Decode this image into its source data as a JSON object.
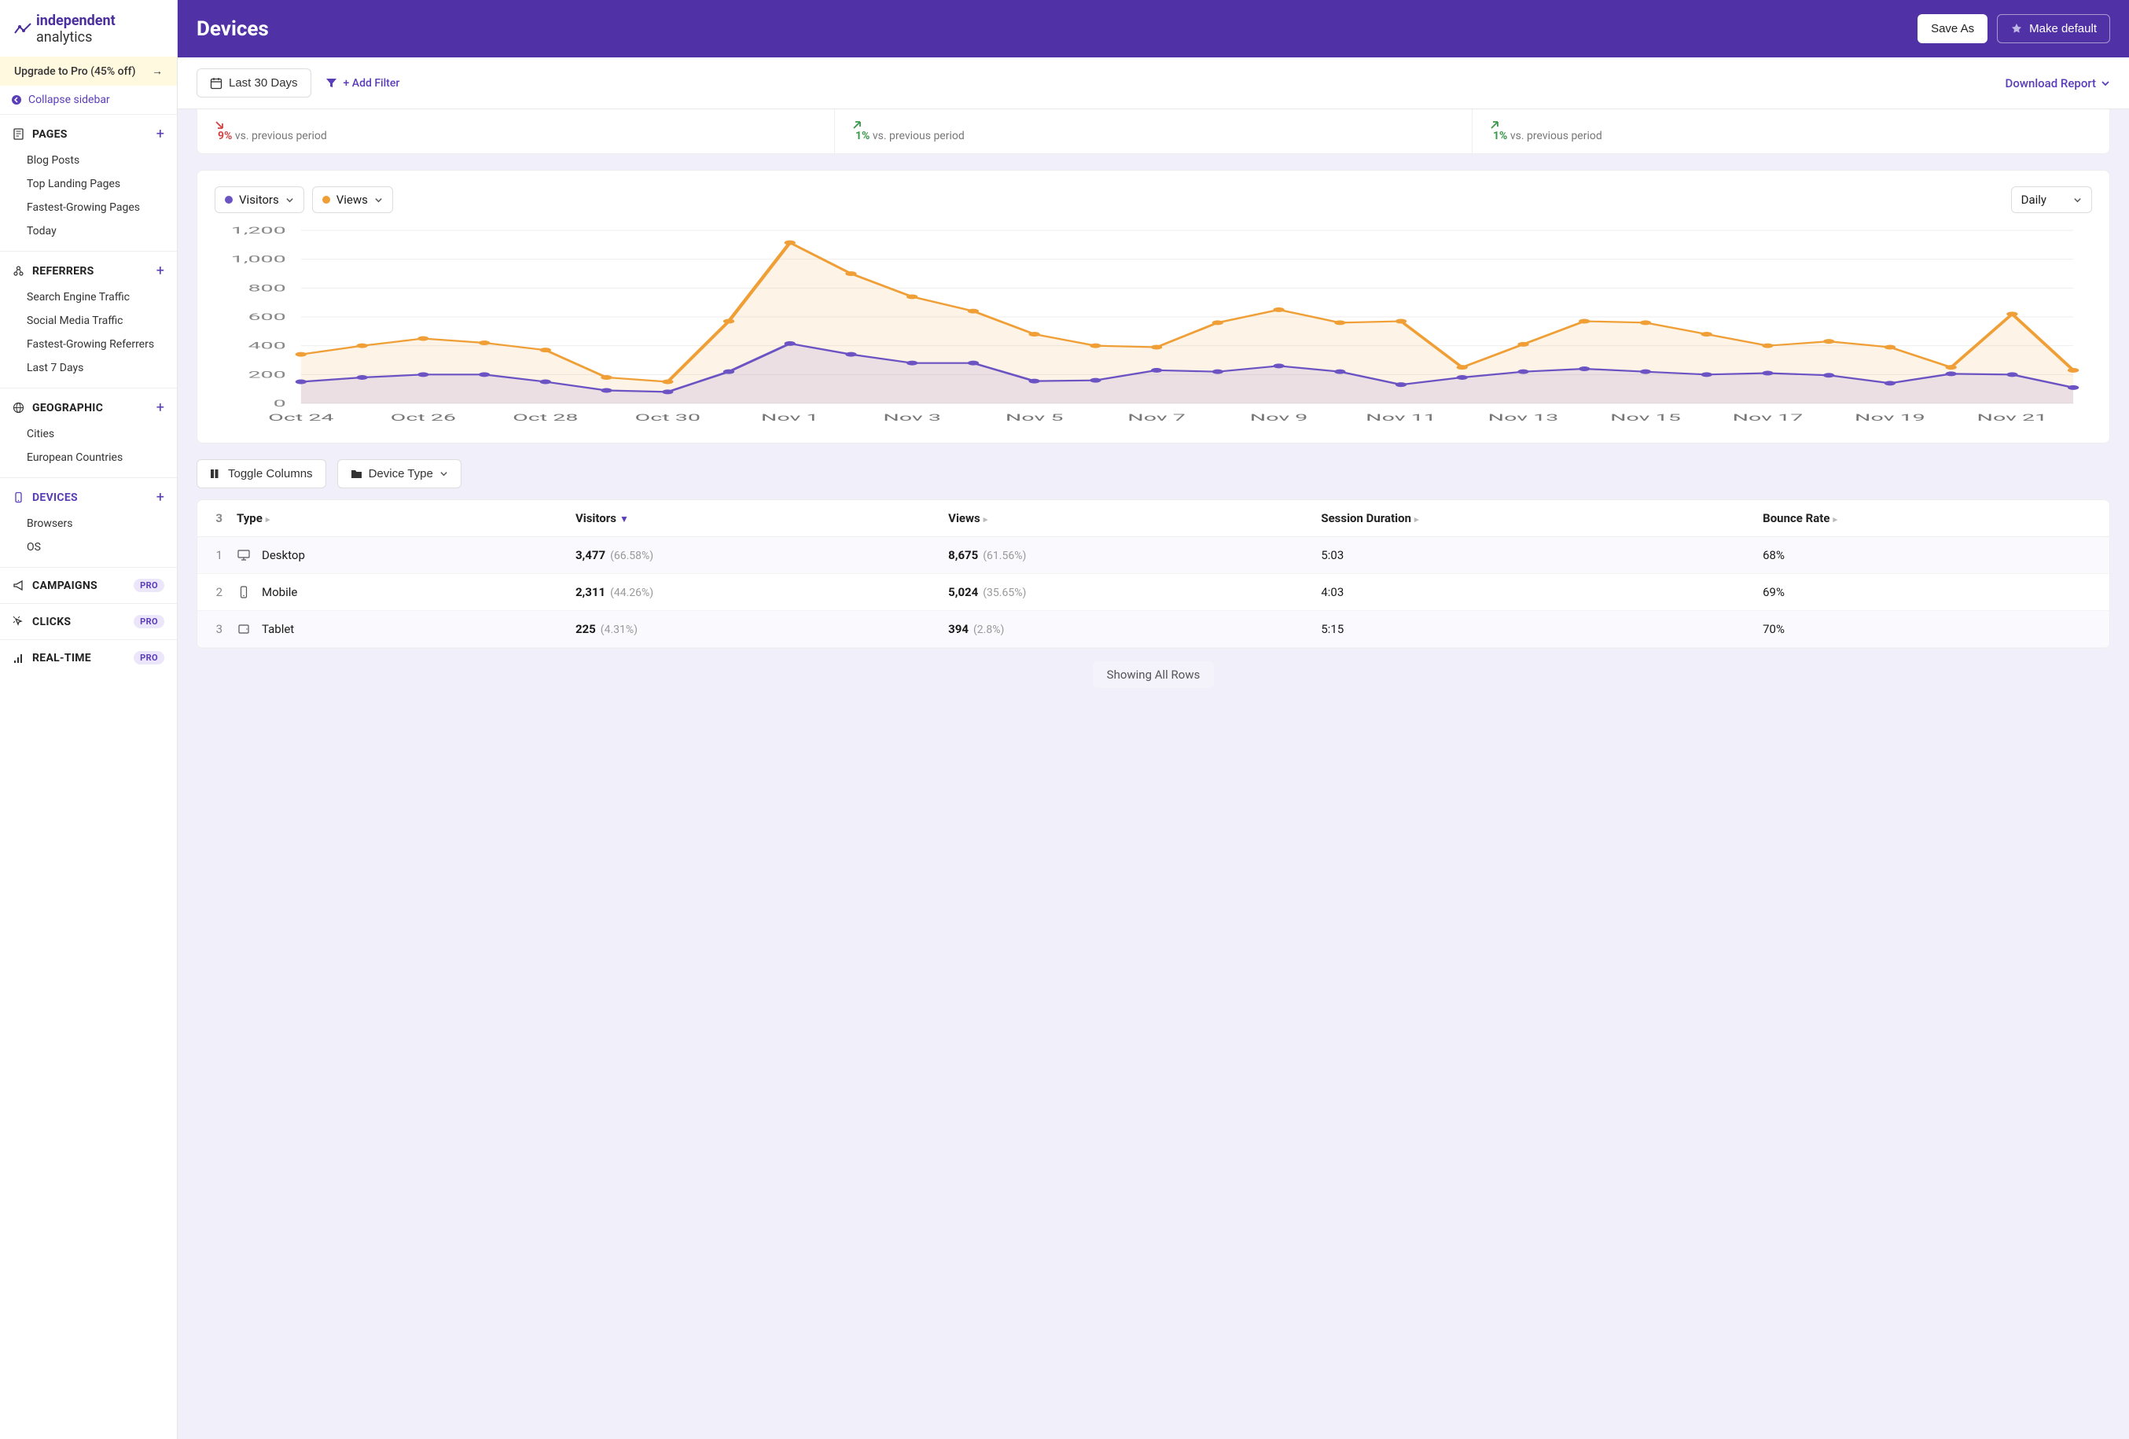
{
  "brand": {
    "name": "independent",
    "suffix": " analytics"
  },
  "sidebar": {
    "upgrade": "Upgrade to Pro (45% off)",
    "collapse": "Collapse sidebar",
    "sections": [
      {
        "title": "PAGES",
        "items": [
          "Blog Posts",
          "Top Landing Pages",
          "Fastest-Growing Pages",
          "Today"
        ]
      },
      {
        "title": "REFERRERS",
        "items": [
          "Search Engine Traffic",
          "Social Media Traffic",
          "Fastest-Growing Referrers",
          "Last 7 Days"
        ]
      },
      {
        "title": "GEOGRAPHIC",
        "items": [
          "Cities",
          "European Countries"
        ]
      },
      {
        "title": "DEVICES",
        "items": [
          "Browsers",
          "OS"
        ],
        "active": true
      }
    ],
    "pro": [
      {
        "title": "CAMPAIGNS"
      },
      {
        "title": "CLICKS"
      },
      {
        "title": "REAL-TIME"
      }
    ],
    "proBadge": "PRO"
  },
  "header": {
    "title": "Devices",
    "saveAs": "Save As",
    "makeDefault": "Make default"
  },
  "toolbar": {
    "dateRange": "Last 30 Days",
    "addFilter": "+ Add Filter",
    "download": "Download Report"
  },
  "kpis": [
    {
      "dir": "down",
      "value": "9%",
      "label": "vs. previous period"
    },
    {
      "dir": "up",
      "value": "1%",
      "label": "vs. previous period"
    },
    {
      "dir": "up",
      "value": "1%",
      "label": "vs. previous period"
    }
  ],
  "chart": {
    "metricA": "Visitors",
    "metricB": "Views",
    "interval": "Daily"
  },
  "chart_data": {
    "type": "line",
    "categories": [
      "Oct 24",
      "Oct 25",
      "Oct 26",
      "Oct 27",
      "Oct 28",
      "Oct 29",
      "Oct 30",
      "Oct 31",
      "Nov 1",
      "Nov 2",
      "Nov 3",
      "Nov 4",
      "Nov 5",
      "Nov 6",
      "Nov 7",
      "Nov 8",
      "Nov 9",
      "Nov 10",
      "Nov 11",
      "Nov 12",
      "Nov 13",
      "Nov 14",
      "Nov 15",
      "Nov 16",
      "Nov 17",
      "Nov 18",
      "Nov 19",
      "Nov 20",
      "Nov 21",
      "Nov 22"
    ],
    "xTickLabels": [
      "Oct 24",
      "Oct 26",
      "Oct 28",
      "Oct 30",
      "Nov 1",
      "Nov 3",
      "Nov 5",
      "Nov 7",
      "Nov 9",
      "Nov 11",
      "Nov 13",
      "Nov 15",
      "Nov 17",
      "Nov 19",
      "Nov 21"
    ],
    "series": [
      {
        "name": "Visitors",
        "color": "#6b53c4",
        "values": [
          150,
          180,
          200,
          200,
          150,
          90,
          80,
          220,
          415,
          340,
          280,
          280,
          155,
          160,
          230,
          220,
          260,
          220,
          130,
          180,
          220,
          240,
          220,
          200,
          210,
          195,
          140,
          205,
          200,
          110
        ]
      },
      {
        "name": "Views",
        "color": "#ef9f36",
        "values": [
          340,
          400,
          450,
          420,
          370,
          180,
          150,
          570,
          1115,
          900,
          740,
          640,
          480,
          400,
          390,
          560,
          650,
          560,
          570,
          250,
          410,
          570,
          560,
          480,
          400,
          430,
          390,
          250,
          620,
          230
        ]
      }
    ],
    "ylabel": "",
    "xlabel": "",
    "ylim": [
      0,
      1200
    ],
    "yTicks": [
      0,
      200,
      400,
      600,
      800,
      1000,
      1200
    ]
  },
  "tableControls": {
    "toggle": "Toggle Columns",
    "deviceType": "Device Type"
  },
  "table": {
    "rowCount": "3",
    "columns": [
      "Type",
      "Visitors",
      "Views",
      "Session Duration",
      "Bounce Rate"
    ],
    "sortDesc": 1,
    "rows": [
      {
        "n": "1",
        "icon": "desktop",
        "type": "Desktop",
        "visitors": "3,477",
        "visitorsPct": "(66.58%)",
        "views": "8,675",
        "viewsPct": "(61.56%)",
        "duration": "5:03",
        "bounce": "68%"
      },
      {
        "n": "2",
        "icon": "mobile",
        "type": "Mobile",
        "visitors": "2,311",
        "visitorsPct": "(44.26%)",
        "views": "5,024",
        "viewsPct": "(35.65%)",
        "duration": "4:03",
        "bounce": "69%"
      },
      {
        "n": "3",
        "icon": "tablet",
        "type": "Tablet",
        "visitors": "225",
        "visitorsPct": "(4.31%)",
        "views": "394",
        "viewsPct": "(2.8%)",
        "duration": "5:15",
        "bounce": "70%"
      }
    ]
  },
  "showing": "Showing All Rows"
}
